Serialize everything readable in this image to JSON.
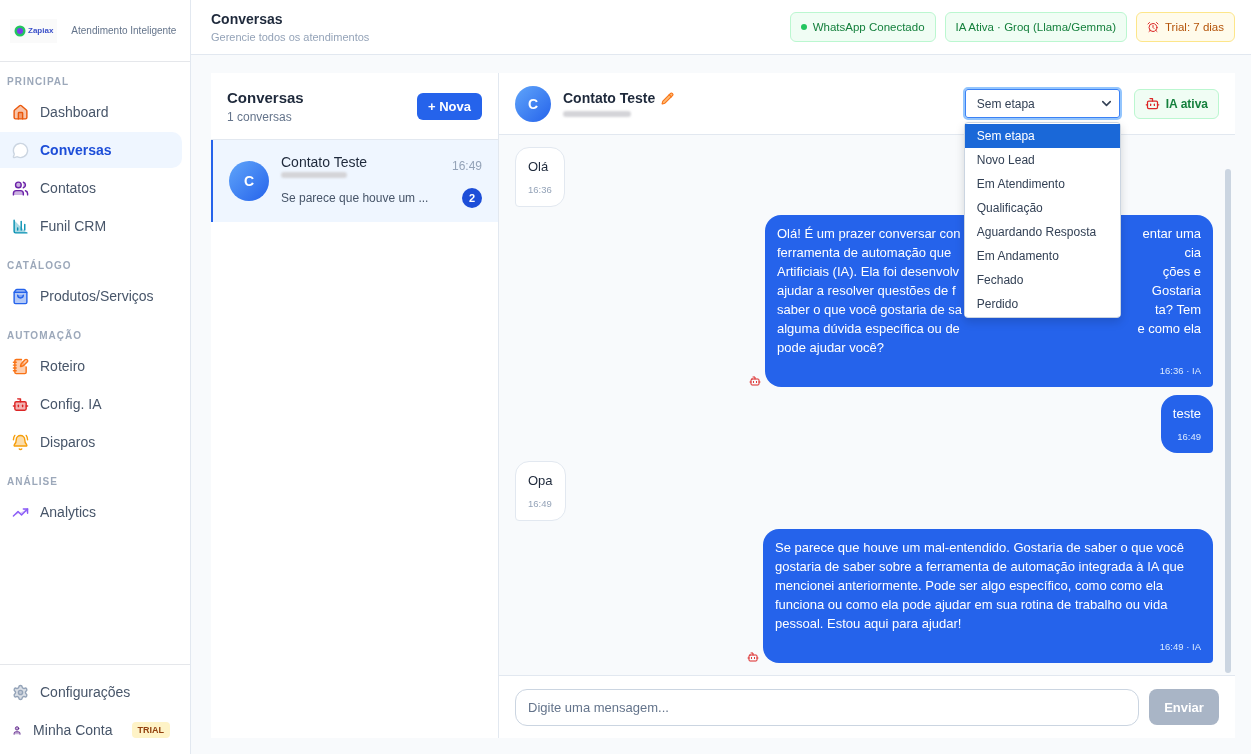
{
  "brand": {
    "logo_text": "Zapiax",
    "tagline": "Atendimento Inteligente"
  },
  "sidebar": {
    "sections": [
      {
        "title": "PRINCIPAL",
        "items": [
          {
            "label": "Dashboard",
            "selected": false
          },
          {
            "label": "Conversas",
            "selected": true
          },
          {
            "label": "Contatos",
            "selected": false
          },
          {
            "label": "Funil CRM",
            "selected": false
          }
        ]
      },
      {
        "title": "CATÁLOGO",
        "items": [
          {
            "label": "Produtos/Serviços",
            "selected": false
          }
        ]
      },
      {
        "title": "AUTOMAÇÃO",
        "items": [
          {
            "label": "Roteiro",
            "selected": false
          },
          {
            "label": "Config. IA",
            "selected": false
          },
          {
            "label": "Disparos",
            "selected": false
          }
        ]
      },
      {
        "title": "ANÁLISE",
        "items": [
          {
            "label": "Analytics",
            "selected": false
          }
        ]
      }
    ],
    "footer": [
      {
        "label": "Configurações"
      },
      {
        "label": "Minha Conta",
        "badge": "TRIAL"
      }
    ]
  },
  "header": {
    "title": "Conversas",
    "subtitle": "Gerencie todos os atendimentos",
    "badges": [
      {
        "kind": "status",
        "label": "WhatsApp Conectado",
        "color": "#22c55e"
      },
      {
        "kind": "info",
        "label": "IA Ativa · Groq (Llama/Gemma)"
      },
      {
        "kind": "warning",
        "label": "Trial: 7 dias"
      }
    ]
  },
  "conversation_list": {
    "title": "Conversas",
    "count": "1 conversas",
    "new_button": "+ Nova",
    "items": [
      {
        "avatar": "C",
        "name": "Contato Teste",
        "time": "16:49",
        "preview": "Se parece que houve um ...",
        "unread": "2",
        "selected": true
      }
    ]
  },
  "chat": {
    "avatar": "C",
    "name": "Contato Teste",
    "stage_select": {
      "value": "Sem etapa",
      "open": true,
      "options": [
        {
          "label": "Sem etapa",
          "selected": true
        },
        {
          "label": "Novo Lead",
          "selected": false
        },
        {
          "label": "Em Atendimento",
          "selected": false
        },
        {
          "label": "Qualificação",
          "selected": false
        },
        {
          "label": "Aguardando Resposta",
          "selected": false
        },
        {
          "label": "Em Andamento",
          "selected": false
        },
        {
          "label": "Fechado",
          "selected": false
        },
        {
          "label": "Perdido",
          "selected": false
        }
      ]
    },
    "ai_button": "IA ativa",
    "messages": [
      {
        "kind": "received",
        "text": "Olá",
        "time": "16:36"
      },
      {
        "kind": "ai",
        "lines": [
          [
            "Olá! É um prazer conversar con",
            "entar uma"
          ],
          [
            "ferramenta de automação que",
            "cia"
          ],
          [
            "Artificiais (IA). Ela foi desenvolv",
            "ções e"
          ],
          [
            "ajudar a resolver questões de f",
            "Gostaria"
          ],
          [
            "saber o que você gostaria de sa",
            "ta? Tem"
          ],
          [
            "alguma dúvida específica ou de",
            "e como ela"
          ],
          [
            "pode ajudar você?"
          ]
        ],
        "time": "16:36 · IA"
      },
      {
        "kind": "sent",
        "text": "teste",
        "time": "16:49"
      },
      {
        "kind": "received",
        "text": "Opa",
        "time": "16:49"
      },
      {
        "kind": "ai",
        "text": "Se parece que houve um mal-entendido. Gostaria de saber o que você gostaria de saber sobre a ferramenta de automação integrada à IA que mencionei anteriormente. Pode ser algo específico, como como ela funciona ou como ela pode ajudar em sua rotina de trabalho ou vida pessoal. Estou aqui para ajudar!",
        "time": "16:49 · IA"
      }
    ],
    "input": {
      "placeholder": "Digite uma mensagem...",
      "send_button": "Enviar",
      "disabled": true
    }
  }
}
